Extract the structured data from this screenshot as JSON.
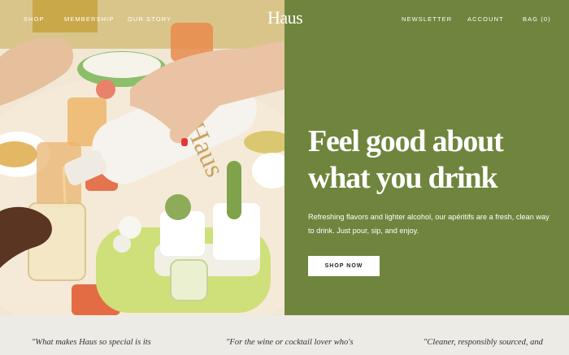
{
  "nav": {
    "left_links": [
      "SHOP",
      "MEMBERSHIP",
      "OUR STORY"
    ],
    "logo": "Haus",
    "right_links": [
      "NEWSLETTER",
      "ACCOUNT",
      "BAG (0)"
    ]
  },
  "hero": {
    "headline_line1": "Feel good about",
    "headline_line2": "what you drink",
    "subcopy": "Refreshing flavors and lighter alcohol, our apéritifs are a fresh, clean way to drink. Just pour, sip, and enjoy.",
    "cta_label": "SHOP NOW",
    "bottle_label": "Haus",
    "colors": {
      "panel": "#6f853d",
      "cta_bg": "#ffffff"
    }
  },
  "testimonials": [
    "\"What makes Haus so special is its",
    "\"For the wine or cocktail lover who's",
    "\"Cleaner, responsibly sourced, and"
  ]
}
